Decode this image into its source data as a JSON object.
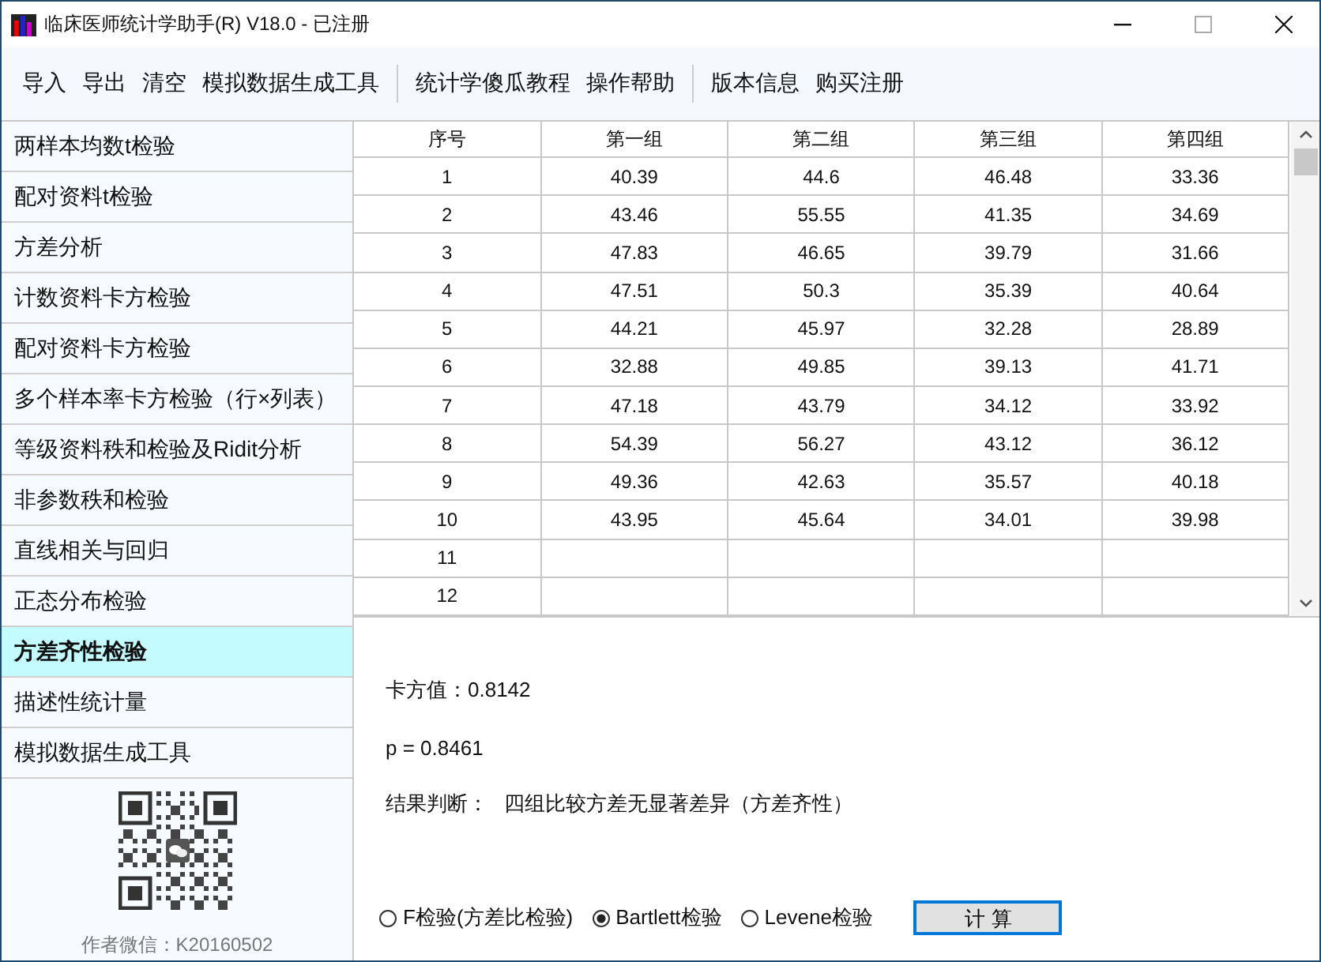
{
  "window": {
    "title": "临床医师统计学助手(R) V18.0 - 已注册"
  },
  "toolbar": {
    "groups": [
      [
        "导入",
        "导出",
        "清空",
        "模拟数据生成工具"
      ],
      [
        "统计学傻瓜教程",
        "操作帮助"
      ],
      [
        "版本信息",
        "购买注册"
      ]
    ]
  },
  "sidebar": {
    "items": [
      {
        "label": "两样本均数t检验",
        "selected": false
      },
      {
        "label": "配对资料t检验",
        "selected": false
      },
      {
        "label": "方差分析",
        "selected": false
      },
      {
        "label": "计数资料卡方检验",
        "selected": false
      },
      {
        "label": "配对资料卡方检验",
        "selected": false
      },
      {
        "label": "多个样本率卡方检验（行×列表）",
        "selected": false
      },
      {
        "label": "等级资料秩和检验及Ridit分析",
        "selected": false
      },
      {
        "label": "非参数秩和检验",
        "selected": false
      },
      {
        "label": "直线相关与回归",
        "selected": false
      },
      {
        "label": "正态分布检验",
        "selected": false
      },
      {
        "label": "方差齐性检验",
        "selected": true
      },
      {
        "label": "描述性统计量",
        "selected": false
      },
      {
        "label": "模拟数据生成工具",
        "selected": false
      }
    ],
    "qr_caption": "作者微信：K20160502"
  },
  "table": {
    "columns": [
      "序号",
      "第一组",
      "第二组",
      "第三组",
      "第四组"
    ],
    "rows": [
      {
        "index": "1",
        "values": [
          "40.39",
          "44.6",
          "46.48",
          "33.36"
        ]
      },
      {
        "index": "2",
        "values": [
          "43.46",
          "55.55",
          "41.35",
          "34.69"
        ]
      },
      {
        "index": "3",
        "values": [
          "47.83",
          "46.65",
          "39.79",
          "31.66"
        ]
      },
      {
        "index": "4",
        "values": [
          "47.51",
          "50.3",
          "35.39",
          "40.64"
        ]
      },
      {
        "index": "5",
        "values": [
          "44.21",
          "45.97",
          "32.28",
          "28.89"
        ]
      },
      {
        "index": "6",
        "values": [
          "32.88",
          "49.85",
          "39.13",
          "41.71"
        ]
      },
      {
        "index": "7",
        "values": [
          "47.18",
          "43.79",
          "34.12",
          "33.92"
        ]
      },
      {
        "index": "8",
        "values": [
          "54.39",
          "56.27",
          "43.12",
          "36.12"
        ]
      },
      {
        "index": "9",
        "values": [
          "49.36",
          "42.63",
          "35.57",
          "40.18"
        ]
      },
      {
        "index": "10",
        "values": [
          "43.95",
          "45.64",
          "34.01",
          "39.98"
        ]
      },
      {
        "index": "11"
      },
      {
        "index": "12"
      }
    ]
  },
  "results": {
    "chi_square": "卡方值：0.8142",
    "p_value": "p = 0.8461",
    "conclusion_label": "结果判断：",
    "conclusion": "四组比较方差无显著差异（方差齐性）"
  },
  "methods": [
    {
      "label": "F检验(方差比检验)",
      "selected": false
    },
    {
      "label": "Bartlett检验",
      "selected": true
    },
    {
      "label": "Levene检验",
      "selected": false
    }
  ],
  "compute_button": "计 算"
}
